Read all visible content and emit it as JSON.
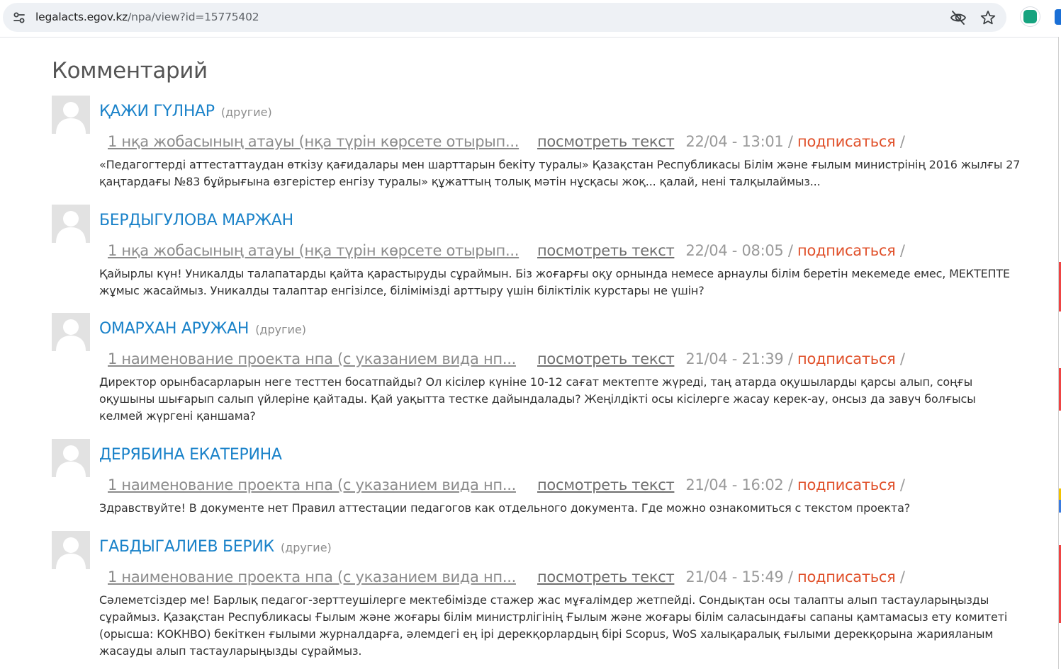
{
  "browser": {
    "url_host": "legalacts.egov.kz",
    "url_path": "/npa/view?id=15775402"
  },
  "page": {
    "title": "Комментарий"
  },
  "labels": {
    "view_text": "посмотреть текст",
    "subscribe": "подписаться",
    "separator": "/"
  },
  "comments": [
    {
      "author": "ҚАЖИ ГҮЛНАР",
      "tag": "(другие)",
      "doc_title": "1 нқа жобасының атауы (нқа түрін көрсете отырып...",
      "date": "22/04 - 13:01",
      "text": "«Педагогтерді аттестаттаудан өткізу қағидалары мен шарттарын бекіту туралы» Қазақстан Республикасы Білім және ғылым министрінің 2016 жылғы 27 қаңтардағы №83 бұйрығына өзгерістер енгізу туралы» құжаттың толық мәтін нұсқасы жоқ... қалай, нені талқылаймыз..."
    },
    {
      "author": "БЕРДЫГУЛОВА МАРЖАН",
      "tag": "",
      "doc_title": "1 нқа жобасының атауы (нқа түрін көрсете отырып...",
      "date": "22/04 - 08:05",
      "text": "Қайырлы күн! Уникалды талапатарды қайта қарастыруды сұраймын. Біз жоғарғы оқу орнында немесе арнаулы білім беретін мекемеде емес, МЕКТЕПТЕ жұмыс жасаймыз. Уникалды талаптар енгізілсе, білімімізді арттыру үшін біліктілік курстары не үшін?"
    },
    {
      "author": "ОМАРХАН АРУЖАН",
      "tag": "(другие)",
      "doc_title": "1 наименование проекта нпа (с указанием вида нп...",
      "date": "21/04 - 21:39",
      "text": "Директор орынбасарларын неге тесттен босатпайды? Ол кісілер күніне 10-12 сағат мектепте жүреді, таң атарда оқушыларды қарсы алып, соңғы оқушыны шығарып салып үйлеріне қайтады. Қай уақытта тестке дайындалады? Жеңілдікті осы кісілерге жасау керек-ау, онсыз да завуч болғысы келмей жүргені қаншама?"
    },
    {
      "author": "ДЕРЯБИНА ЕКАТЕРИНА",
      "tag": "",
      "doc_title": "1 наименование проекта нпа (с указанием вида нп...",
      "date": "21/04 - 16:02",
      "text": "Здравствуйте! В документе нет Правил аттестации педагогов как отдельного документа. Где можно ознакомиться с текстом проекта?"
    },
    {
      "author": "ГАБДЫГАЛИЕВ БЕРИК",
      "tag": "(другие)",
      "doc_title": "1 наименование проекта нпа (с указанием вида нп...",
      "date": "21/04 - 15:49",
      "text": "Сәлеметсіздер ме! Барлық педагог-зерттеушілерге мектебімізде стажер жас мұғалімдер жетпейді. Сондықтан осы талапты алып тастауларыңызды сұраймыз. Қазақстан Республикасы Ғылым және жоғары білім министрлігінің Ғылым және жоғары білім саласындағы сапаны қамтамасыз ету комитеті (орысша: КОКНВО) бекіткен ғылыми журналдарға, әлемдегі ең ірі дерекқорлардың бірі Scopus, WoS халықаралық ғылыми дерекқорына жарияланым жасауды алып тастауларыңызды сұраймыз."
    }
  ]
}
